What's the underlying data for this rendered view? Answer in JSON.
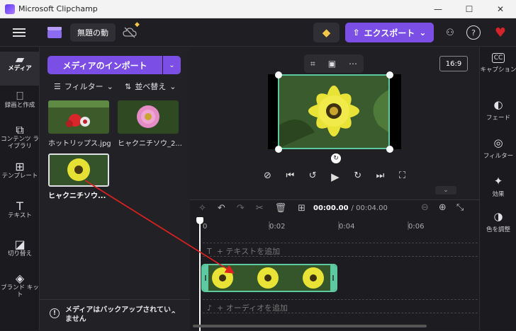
{
  "window": {
    "title": "Microsoft Clipchamp",
    "minimize": "—",
    "maximize": "☐",
    "close": "✕"
  },
  "topbar": {
    "project_name": "無題の​動",
    "export_label": "エクスポート",
    "export_caret": "⌄"
  },
  "nav": [
    {
      "label": "メディア",
      "icon": "folder-icon",
      "glyph": "▮"
    },
    {
      "label": "録画と作成",
      "icon": "camera-icon",
      "glyph": "▭"
    },
    {
      "label": "コンテンツ ライブラリ",
      "icon": "library-icon",
      "glyph": "⧉"
    },
    {
      "label": "テンプレート",
      "icon": "template-icon",
      "glyph": "⊞"
    },
    {
      "label": "テキスト",
      "icon": "text-icon",
      "glyph": "T"
    },
    {
      "label": "切り替え",
      "icon": "transition-icon",
      "glyph": "◪"
    },
    {
      "label": "ブランド キット",
      "icon": "brand-kit-icon",
      "glyph": "◈"
    }
  ],
  "media": {
    "import_label": "メディアのインポート",
    "filter_label": "フィルター",
    "sort_label": "並べ替え",
    "items": [
      {
        "caption": "ホットリップス.jpg"
      },
      {
        "caption": "ヒャクニチソウ_2..."
      },
      {
        "caption": "ヒャクニチソウ..."
      }
    ],
    "backup_text": "メディアはバックアップされていません"
  },
  "preview": {
    "aspect": "16:9"
  },
  "timeline": {
    "current": "00:00.00",
    "total": "/ 00:04.00",
    "ticks": [
      "0",
      "0:02",
      "0:04",
      "0:06"
    ],
    "text_track": "+ テキストを追加",
    "audio_track": "+ オーディオを追加"
  },
  "rightpanel": [
    {
      "label": "キャプション",
      "icon": "captions-icon",
      "glyph": "CC"
    },
    {
      "label": "フェード",
      "icon": "fade-icon",
      "glyph": "◐"
    },
    {
      "label": "フィルター",
      "icon": "filter-icon",
      "glyph": "◎"
    },
    {
      "label": "効果",
      "icon": "effects-icon",
      "glyph": "✦"
    },
    {
      "label": "色を調整",
      "icon": "color-adjust-icon",
      "glyph": "◑"
    }
  ],
  "colors": {
    "accent": "#7b4fe6",
    "clip_border": "#5cc9a0",
    "arrow": "#e02020"
  }
}
